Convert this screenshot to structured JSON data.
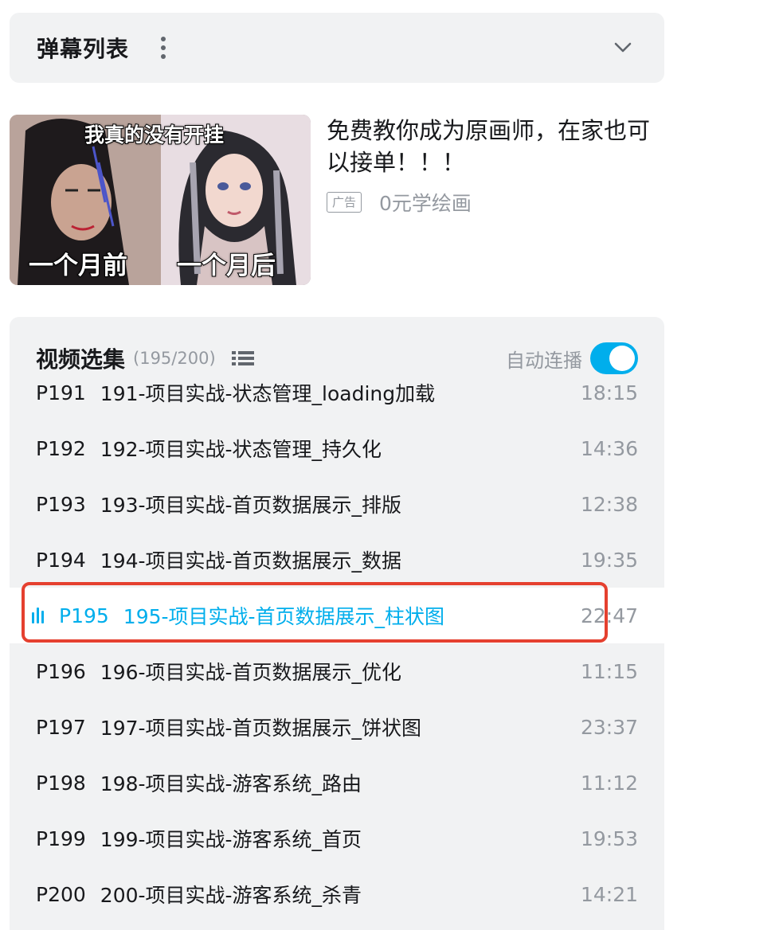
{
  "danmaku": {
    "title": "弹幕列表"
  },
  "ad": {
    "thumb_text_top": "我真的没有开挂",
    "thumb_text_left": "一个月前",
    "thumb_text_right": "一个月后",
    "title": "免费教你成为原画师，在家也可以接单！！！",
    "badge": "广告",
    "subtitle": "0元学绘画"
  },
  "episodes": {
    "title": "视频选集",
    "count": "(195/200)",
    "autoplay_label": "自动连播",
    "autoplay_on": true,
    "accent_color": "#00aeec",
    "items": [
      {
        "code": "P191",
        "title": "191-项目实战-状态管理_loading加载",
        "duration": "18:15"
      },
      {
        "code": "P192",
        "title": "192-项目实战-状态管理_持久化",
        "duration": "14:36"
      },
      {
        "code": "P193",
        "title": "193-项目实战-首页数据展示_排版",
        "duration": "12:38"
      },
      {
        "code": "P194",
        "title": "194-项目实战-首页数据展示_数据",
        "duration": "19:35"
      },
      {
        "code": "P195",
        "title": "195-项目实战-首页数据展示_柱状图",
        "duration": "22:47",
        "active": true
      },
      {
        "code": "P196",
        "title": "196-项目实战-首页数据展示_优化",
        "duration": "11:15"
      },
      {
        "code": "P197",
        "title": "197-项目实战-首页数据展示_饼状图",
        "duration": "23:37"
      },
      {
        "code": "P198",
        "title": "198-项目实战-游客系统_路由",
        "duration": "11:12"
      },
      {
        "code": "P199",
        "title": "199-项目实战-游客系统_首页",
        "duration": "19:53"
      },
      {
        "code": "P200",
        "title": "200-项目实战-游客系统_杀青",
        "duration": "14:21"
      }
    ]
  }
}
